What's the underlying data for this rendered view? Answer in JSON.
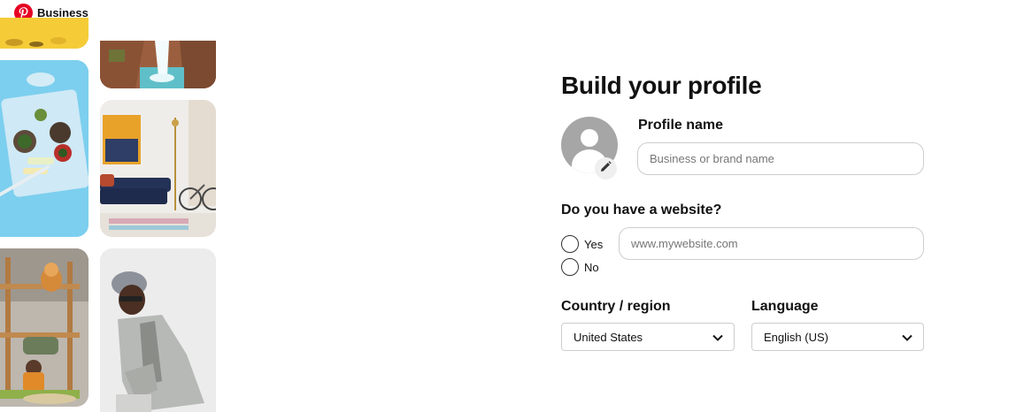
{
  "header": {
    "logo_icon": "pinterest-logo-icon",
    "brand_label": "Business",
    "brand_color": "#e60023"
  },
  "collage": {
    "images": [
      {
        "name": "yellow-food-image"
      },
      {
        "name": "waterfall-image"
      },
      {
        "name": "food-tray-image"
      },
      {
        "name": "living-room-image"
      },
      {
        "name": "playground-image"
      },
      {
        "name": "man-in-jacket-image"
      }
    ]
  },
  "form": {
    "title": "Build your profile",
    "profile_name": {
      "label": "Profile name",
      "value": "",
      "placeholder": "Business or brand name"
    },
    "avatar": {
      "edit_icon": "pencil-icon"
    },
    "website": {
      "question": "Do you have a website?",
      "options": [
        {
          "label": "Yes",
          "selected": false
        },
        {
          "label": "No",
          "selected": false
        }
      ],
      "value": "",
      "placeholder": "www.mywebsite.com"
    },
    "country": {
      "label": "Country / region",
      "selected": "United States"
    },
    "language": {
      "label": "Language",
      "selected": "English (US)"
    }
  }
}
